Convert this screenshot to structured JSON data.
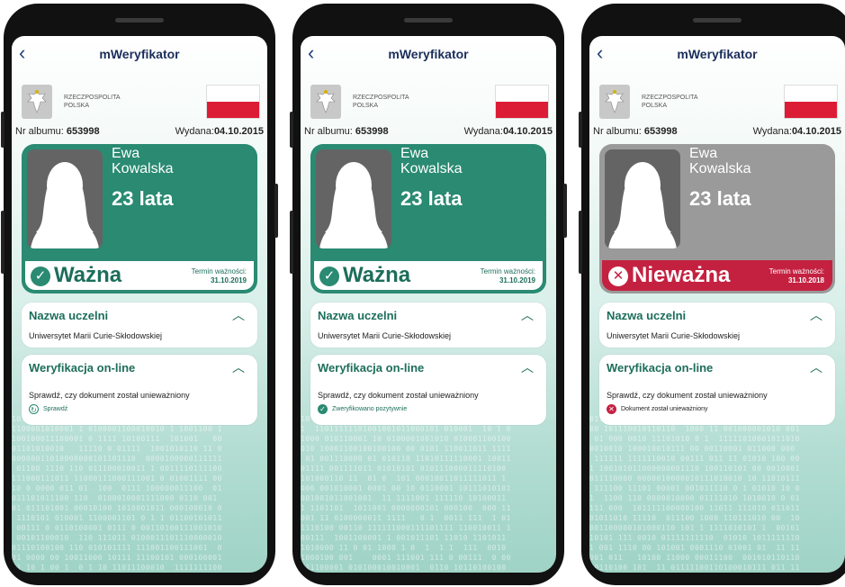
{
  "phones": [
    {
      "title": "mWeryfikator",
      "country_line1": "RZECZPOSPOLITA",
      "country_line2": "POLSKA",
      "album_label": "Nr albumu:",
      "album_number": "653998",
      "issued_label": "Wydana:",
      "issued_date": "04.10.2015",
      "first_name": "Ewa",
      "last_name": "Kowalska",
      "age": "23 lata",
      "status": "Ważna",
      "status_icon": "✓",
      "status_state": "valid",
      "term_label": "Termin ważności:",
      "term_date": "31.10.2019",
      "uni_header": "Nazwa uczelni",
      "uni_name": "Uniwersytet Marii Curie-Skłodowskiej",
      "verify_header": "Weryfikacja on-line",
      "verify_text": "Sprawdź, czy dokument został unieważniony",
      "verify_action": "Sprawdź",
      "verify_icon": "↻",
      "verify_state": "refresh"
    },
    {
      "title": "mWeryfikator",
      "country_line1": "RZECZPOSPOLITA",
      "country_line2": "POLSKA",
      "album_label": "Nr albumu:",
      "album_number": "653998",
      "issued_label": "Wydana:",
      "issued_date": "04.10.2015",
      "first_name": "Ewa",
      "last_name": "Kowalska",
      "age": "23 lata",
      "status": "Ważna",
      "status_icon": "✓",
      "status_state": "valid",
      "term_label": "Termin ważności:",
      "term_date": "31.10.2019",
      "uni_header": "Nazwa uczelni",
      "uni_name": "Uniwersytet Marii Curie-Skłodowskiej",
      "verify_header": "Weryfikacja on-line",
      "verify_text": "Sprawdź, czy dokument został unieważniony",
      "verify_action": "Zweryfikowano pozytywnie",
      "verify_icon": "✓",
      "verify_state": "ok"
    },
    {
      "title": "mWeryfikator",
      "country_line1": "RZECZPOSPOLITA",
      "country_line2": "POLSKA",
      "album_label": "Nr albumu:",
      "album_number": "653998",
      "issued_label": "Wydana:",
      "issued_date": "04.10.2015",
      "first_name": "Ewa",
      "last_name": "Kowalska",
      "age": "23 lata",
      "status": "Nieważna",
      "status_icon": "✕",
      "status_state": "invalid",
      "term_label": "Termin ważności:",
      "term_date": "31.10.2018",
      "uni_header": "Nazwa uczelni",
      "uni_name": "Uniwersytet Marii Curie-Skłodowskiej",
      "verify_header": "Weryfikacja on-line",
      "verify_text": "Sprawdź, czy dokument został unieważniony",
      "verify_action": "Dokument został unieważniony",
      "verify_icon": "✕",
      "verify_state": "bad"
    }
  ],
  "colors": {
    "accent_green": "#2a8a72",
    "invalid_red": "#c42140",
    "flag_red": "#dc1c35",
    "title_navy": "#1a2e5a"
  }
}
